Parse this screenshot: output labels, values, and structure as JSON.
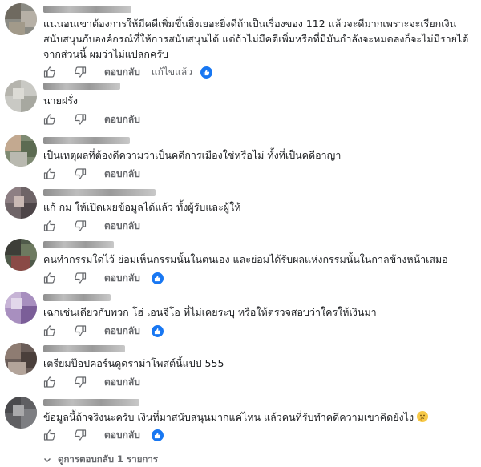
{
  "comments": [
    {
      "text": "แน่นอนเขาต้องการให้มีคดีเพิ่มขึ้นยิ่งเยอะยิ่งดีถ้าเป็นเรื่องของ 112 แล้วจะดีมากเพราะจะเรียกเงินสนับสนุนกับองค์กรณ์ที่ให้การสนับสนุนได้ แต่ถ้าไม่มีคดีเพิ่มหรือที่มีมันกำลังจะหมดลงก็จะไม่มีรายได้จากส่วนนี้ ผมว่าไม่แปลกครับ",
      "reply": "ตอบกลับ",
      "edited": "แก้ไขแล้ว",
      "has_reaction": true
    },
    {
      "text": "นายฝรั่ง",
      "reply": "ตอบกลับ",
      "has_reaction": false
    },
    {
      "text": "เป็นเหตุผลที่ต้องดีความว่าเป็นคดีการเมืองใช่หรือไม่ ทั้งที่เป็นคดีอาญา",
      "reply": "ตอบกลับ",
      "has_reaction": false
    },
    {
      "text": "แก้ กม ให้เปิดเผยข้อมูลได้แล้ว ทั้งผู้รับและผู้ให้",
      "reply": "ตอบกลับ",
      "has_reaction": false
    },
    {
      "text": "คนทำกรรมใดไว้ ย่อมเห็นกรรมนั้นในตนเอง และย่อมได้รับผลแห่งกรรมนั้นในกาลข้างหน้าเสมอ",
      "reply": "ตอบกลับ",
      "has_reaction": true
    },
    {
      "text": "เฉกเช่นเดียวกับพวก โฮ่ เอนจีโอ ที่ไม่เคยระบุ หรือให้ตรวจสอบว่าใครให้เงินมา",
      "reply": "ตอบกลับ",
      "has_reaction": true
    },
    {
      "text": "เตรียมป๊อปคอร์นดูดราม่าโพสต์นี้แปป 555",
      "reply": "ตอบกลับ",
      "has_reaction": false
    },
    {
      "text": "ข้อมูลนี้ถ้าจริงนะครับ เงินที่มาสนับสนุนมากแค่ไหน แล้วคนที่รับทำคดีความเขาคิดยังไง",
      "reply": "ตอบกลับ",
      "has_reaction": true,
      "emoji": "thinking-face"
    }
  ],
  "view_replies": "ดูการตอบกลับ 1 รายการ",
  "colors": {
    "accent": "#1877f2",
    "muted": "#65676b",
    "text": "#1c1e21"
  },
  "icons": [
    "thumbs-up-icon",
    "thumbs-down-icon",
    "like-reaction-icon",
    "chevron-down-icon",
    "thinking-face-emoji"
  ]
}
